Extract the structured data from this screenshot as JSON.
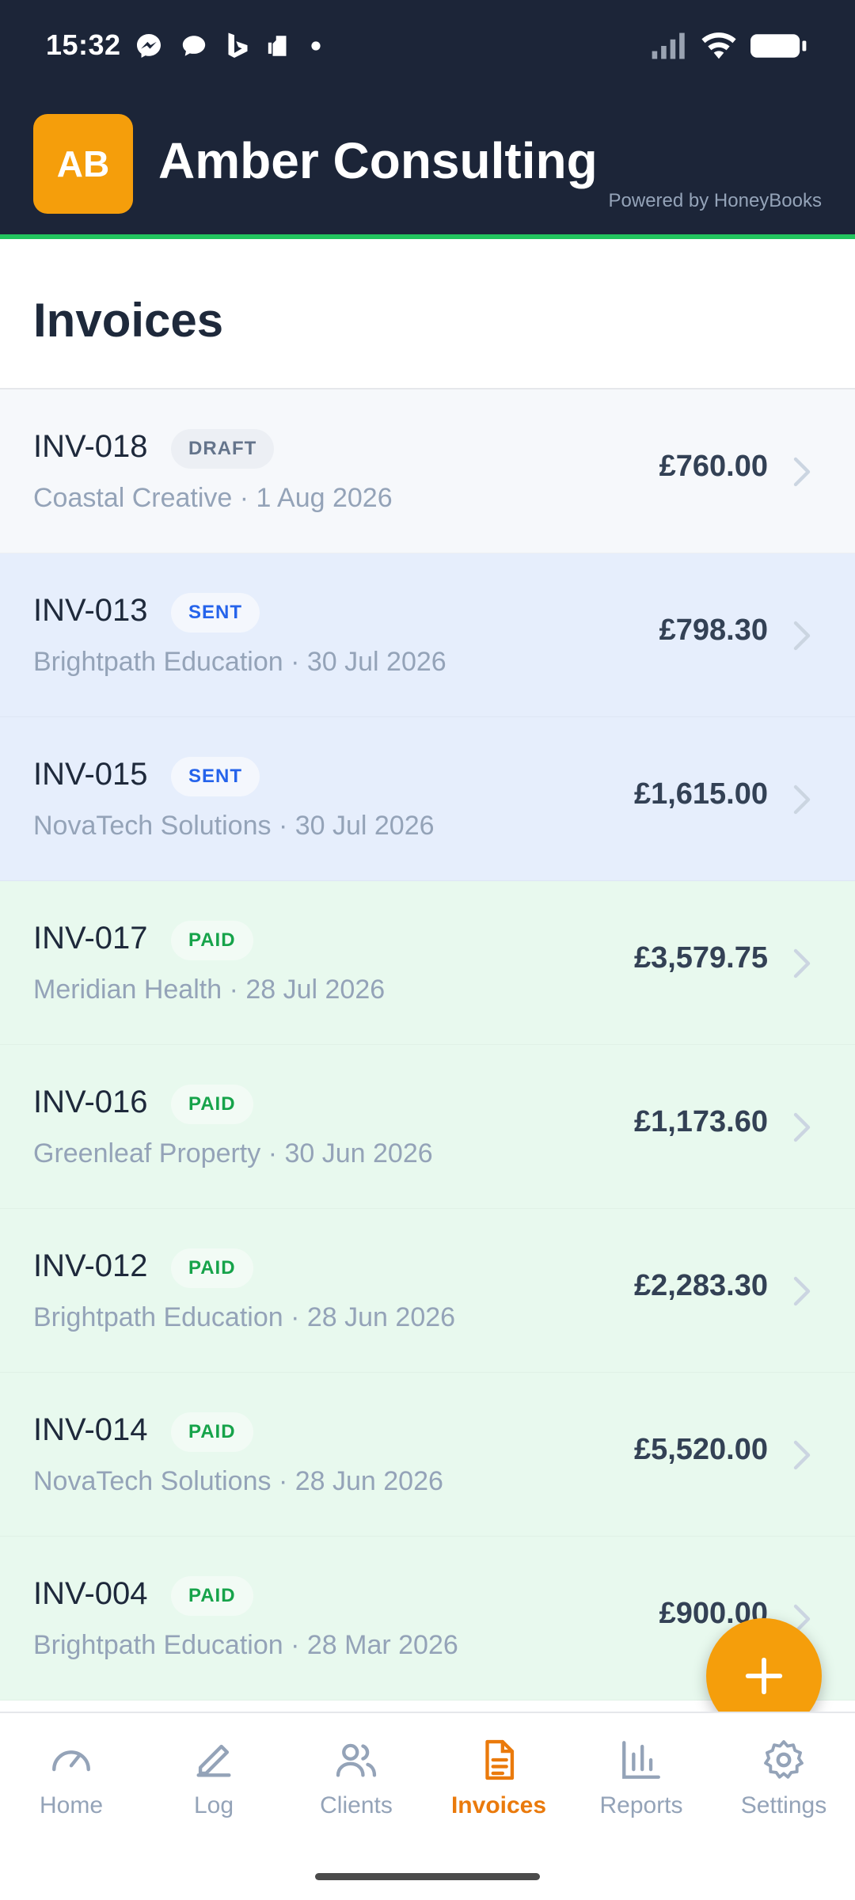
{
  "status_bar": {
    "time": "15:32",
    "left_icons": [
      "messenger-icon",
      "chat-bubble-icon",
      "bing-icon",
      "sim-icon",
      "dot-icon"
    ],
    "right_icons": [
      "signal-icon",
      "wifi-icon",
      "battery-icon"
    ]
  },
  "header": {
    "avatar_initials": "AB",
    "business_name": "Amber Consulting",
    "powered_by": "Powered by HoneyBooks",
    "colors": {
      "background": "#1c2538",
      "accent_line": "#22c55e",
      "avatar": "#f59e0b"
    }
  },
  "page": {
    "title": "Invoices"
  },
  "invoices": [
    {
      "number": "INV-018",
      "status": "DRAFT",
      "subtitle": "Coastal Creative · 1 Aug 2026",
      "amount": "£760.00"
    },
    {
      "number": "INV-013",
      "status": "SENT",
      "subtitle": "Brightpath Education · 30 Jul 2026",
      "amount": "£798.30"
    },
    {
      "number": "INV-015",
      "status": "SENT",
      "subtitle": "NovaTech Solutions · 30 Jul 2026",
      "amount": "£1,615.00"
    },
    {
      "number": "INV-017",
      "status": "PAID",
      "subtitle": "Meridian Health · 28 Jul 2026",
      "amount": "£3,579.75"
    },
    {
      "number": "INV-016",
      "status": "PAID",
      "subtitle": "Greenleaf Property · 30 Jun 2026",
      "amount": "£1,173.60"
    },
    {
      "number": "INV-012",
      "status": "PAID",
      "subtitle": "Brightpath Education · 28 Jun 2026",
      "amount": "£2,283.30"
    },
    {
      "number": "INV-014",
      "status": "PAID",
      "subtitle": "NovaTech Solutions · 28 Jun 2026",
      "amount": "£5,520.00"
    },
    {
      "number": "INV-004",
      "status": "PAID",
      "subtitle": "Brightpath Education · 28 Mar 2026",
      "amount": "£900.00"
    }
  ],
  "status_colors": {
    "DRAFT": "#64748b",
    "SENT": "#2563eb",
    "PAID": "#16a34a"
  },
  "fab": {
    "icon": "plus-icon"
  },
  "bottom_nav": {
    "items": [
      {
        "label": "Home",
        "icon": "gauge-icon",
        "active": false
      },
      {
        "label": "Log",
        "icon": "pencil-icon",
        "active": false
      },
      {
        "label": "Clients",
        "icon": "users-icon",
        "active": false
      },
      {
        "label": "Invoices",
        "icon": "document-icon",
        "active": true
      },
      {
        "label": "Reports",
        "icon": "bar-chart-icon",
        "active": false
      },
      {
        "label": "Settings",
        "icon": "gear-icon",
        "active": false
      }
    ],
    "active_color": "#ea7a0c"
  }
}
